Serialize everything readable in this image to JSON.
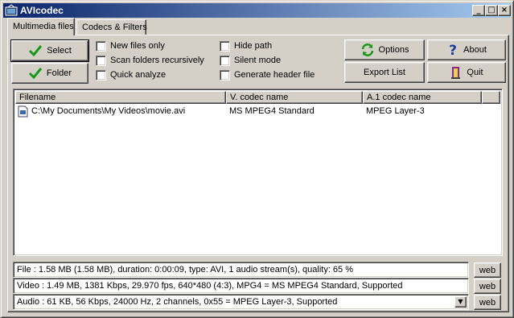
{
  "window": {
    "title": "AVIcodec",
    "minimize_glyph": "_",
    "maximize_glyph": "□",
    "close_glyph": "×"
  },
  "tabs": [
    {
      "label": "Multimedia files",
      "active": true
    },
    {
      "label": "Codecs & Filters",
      "active": false
    }
  ],
  "toolbar": {
    "select": {
      "label": "Select",
      "icon": "green-checkmark-icon"
    },
    "folder": {
      "label": "Folder",
      "icon": "green-checkmark-icon"
    },
    "options": {
      "label": "Options",
      "icon": "refresh-arrows-icon"
    },
    "about": {
      "label": "About",
      "icon": "help-question-icon"
    },
    "export": {
      "label": "Export List"
    },
    "quit": {
      "label": "Quit",
      "icon": "exit-door-icon"
    }
  },
  "options": [
    {
      "label": "New files only",
      "checked": false
    },
    {
      "label": "Scan folders recursively",
      "checked": false
    },
    {
      "label": "Quick analyze",
      "checked": false
    },
    {
      "label": "Hide path",
      "checked": false
    },
    {
      "label": "Silent mode",
      "checked": false
    },
    {
      "label": "Generate header file",
      "checked": false
    }
  ],
  "list": {
    "columns": [
      "Filename",
      "V. codec name",
      "A.1 codec name"
    ],
    "rows": [
      {
        "filename": "C:\\My Documents\\My Videos\\movie.avi",
        "vcodec": "MS MPEG4 Standard",
        "acodec": "MPEG Layer-3"
      }
    ]
  },
  "info": {
    "file": "File   :  1.58 MB (1.58 MB),  duration: 0:00:09,  type: AVI,  1 audio stream(s),  quality: 65 %",
    "video": "Video :  1.49 MB,  1381 Kbps,  29.970 fps,  640*480 (4:3),  MPG4 = MS MPEG4 Standard,    Supported",
    "audio": "Audio :  61 KB,  56 Kbps,  24000 Hz,  2 channels,  0x55 = MPEG Layer-3,    Supported",
    "web_label": "web"
  },
  "colors": {
    "titlebar_start": "#0a246a",
    "titlebar_end": "#a6caf0",
    "face": "#d4d0c8",
    "check_green": "#1a9a1a"
  }
}
